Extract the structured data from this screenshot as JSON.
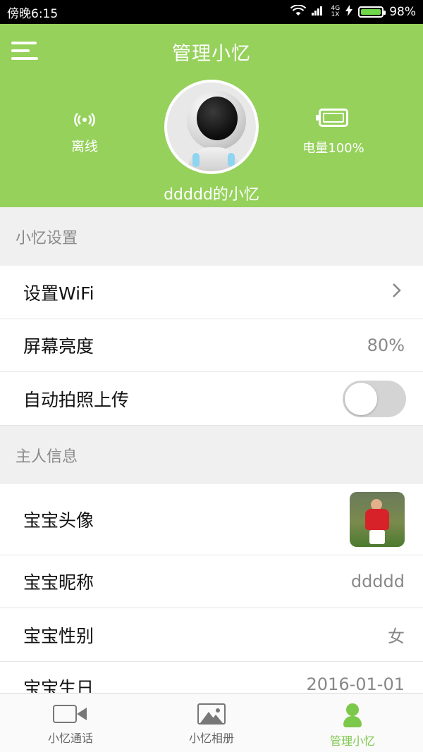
{
  "status_bar": {
    "time": "傍晚6:15",
    "network": [
      "4G",
      "1X"
    ],
    "battery_pct": "98%"
  },
  "header": {
    "title": "管理小忆",
    "connection_status": "离线",
    "battery_label": "电量100%",
    "robot_name": "ddddd的小忆",
    "accent_color": "#95d15b"
  },
  "settings": {
    "section_title": "小忆设置",
    "wifi_label": "设置WiFi",
    "brightness_label": "屏幕亮度",
    "brightness_value": "80%",
    "auto_upload_label": "自动拍照上传",
    "auto_upload_on": false
  },
  "owner": {
    "section_title": "主人信息",
    "avatar_label": "宝宝头像",
    "nickname_label": "宝宝昵称",
    "nickname_value": "ddddd",
    "gender_label": "宝宝性别",
    "gender_value": "女",
    "birthday_label": "宝宝生日",
    "birthday_value": "2016-01-01"
  },
  "bottom_nav": {
    "items": [
      {
        "label": "小忆通话",
        "icon": "video-camera-icon"
      },
      {
        "label": "小忆相册",
        "icon": "photo-album-icon"
      },
      {
        "label": "管理小忆",
        "icon": "person-icon",
        "active": true
      }
    ]
  }
}
